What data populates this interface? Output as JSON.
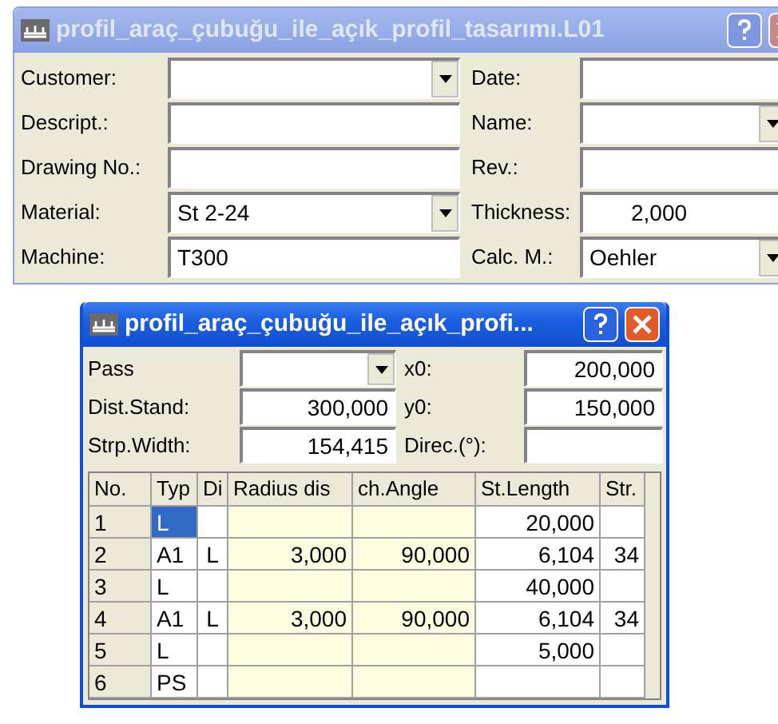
{
  "main_window": {
    "title": "profil_araç_çubuğu_ile_açık_profil_tasarımı.L01",
    "active": false,
    "left_fields": [
      {
        "label": "Customer:",
        "kind": "dropdown"
      },
      {
        "label": "Descript.:",
        "kind": "text"
      },
      {
        "label": "Drawing No.:",
        "kind": "text"
      },
      {
        "label": "Material:",
        "kind": "dropdown",
        "value": "St 2-24"
      },
      {
        "label": "Machine:",
        "kind": "text",
        "value": "T300"
      }
    ],
    "right_fields": [
      {
        "label": "Date:",
        "kind": "text"
      },
      {
        "label": "Name:",
        "kind": "dropdown"
      },
      {
        "label": "Rev.:",
        "kind": "text"
      },
      {
        "label": "Thickness:",
        "kind": "number",
        "value": "2,000"
      },
      {
        "label": "Calc. M.:",
        "kind": "dropdown",
        "value": "Oehler"
      }
    ]
  },
  "pass_window": {
    "title": "profil_araç_çubuğu_ile_açık_profi...",
    "active": true,
    "left_fields": [
      {
        "label": "Pass",
        "kind": "dropdown"
      },
      {
        "label": "Dist.Stand:",
        "kind": "number",
        "value": "300,000"
      },
      {
        "label": "Strp.Width:",
        "kind": "number",
        "value": "154,415"
      }
    ],
    "right_fields": [
      {
        "label": "x0:",
        "kind": "number",
        "value": "200,000"
      },
      {
        "label": "y0:",
        "kind": "number",
        "value": "150,000"
      },
      {
        "label": "Direc.(°):",
        "kind": "number"
      }
    ],
    "table": {
      "columns": [
        "No.",
        "Typ",
        "Di",
        "Radius dis",
        "ch.Angle",
        "St.Length",
        "Str."
      ],
      "rows": [
        {
          "cells": [
            "1",
            "L",
            null,
            null,
            null,
            "20,000",
            null
          ],
          "selected": true
        },
        {
          "cells": [
            "2",
            "A1",
            "L",
            "3,000",
            "90,000",
            "6,104",
            "34"
          ],
          "selected": false
        },
        {
          "cells": [
            "3",
            "L",
            null,
            null,
            null,
            "40,000",
            null
          ],
          "selected": false
        },
        {
          "cells": [
            "4",
            "A1",
            "L",
            "3,000",
            "90,000",
            "6,104",
            "34"
          ],
          "selected": false
        },
        {
          "cells": [
            "5",
            "L",
            null,
            null,
            null,
            "5,000",
            null
          ],
          "selected": false
        },
        {
          "cells": [
            "6",
            "PS",
            null,
            null,
            null,
            null,
            null
          ],
          "selected": false
        }
      ]
    }
  }
}
